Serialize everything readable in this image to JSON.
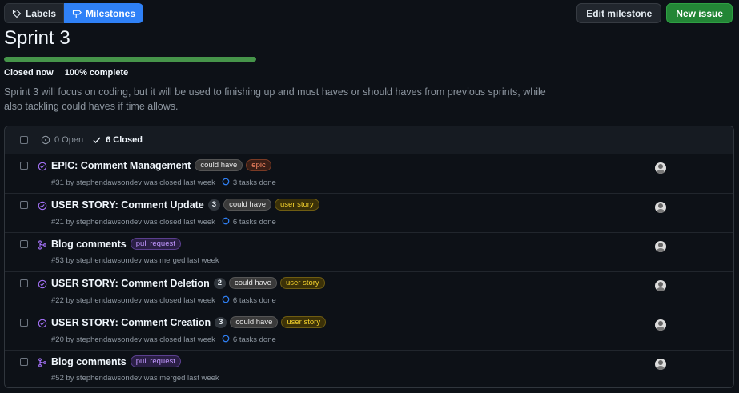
{
  "toolbar": {
    "labels_label": "Labels",
    "milestones_label": "Milestones",
    "edit_milestone_label": "Edit milestone",
    "new_issue_label": "New issue"
  },
  "milestone": {
    "title": "Sprint 3",
    "progress_fraction": 1.0,
    "status": "Closed now",
    "percent_complete": "100% complete",
    "description": "Sprint 3 will focus on coding, but it will be used to finishing up and must haves or should haves from previous sprints, while also tackling could haves if time allows."
  },
  "list_header": {
    "open_label": "0 Open",
    "closed_label": "6 Closed"
  },
  "colors": {
    "accent": "#2f81f7",
    "closed_purple": "#a371f7",
    "primary_green": "#238636"
  },
  "items": [
    {
      "kind": "issue",
      "state_icon": "check-circle-icon",
      "title": "EPIC: Comment Management",
      "count": "",
      "labels": [
        {
          "text": "could have",
          "style": "l-could"
        },
        {
          "text": "epic",
          "style": "l-epic"
        }
      ],
      "meta": "#31 by stephendawsondev was closed last week",
      "tasks": "3 tasks done"
    },
    {
      "kind": "issue",
      "state_icon": "check-circle-icon",
      "title": "USER STORY: Comment Update",
      "count": "3",
      "labels": [
        {
          "text": "could have",
          "style": "l-could"
        },
        {
          "text": "user story",
          "style": "l-story"
        }
      ],
      "meta": "#21 by stephendawsondev was closed last week",
      "tasks": "6 tasks done"
    },
    {
      "kind": "pr",
      "state_icon": "merge-icon",
      "title": "Blog comments",
      "count": "",
      "labels": [
        {
          "text": "pull request",
          "style": "l-pr"
        }
      ],
      "meta": "#53 by stephendawsondev was merged last week",
      "tasks": ""
    },
    {
      "kind": "issue",
      "state_icon": "check-circle-icon",
      "title": "USER STORY: Comment Deletion",
      "count": "2",
      "labels": [
        {
          "text": "could have",
          "style": "l-could"
        },
        {
          "text": "user story",
          "style": "l-story"
        }
      ],
      "meta": "#22 by stephendawsondev was closed last week",
      "tasks": "6 tasks done"
    },
    {
      "kind": "issue",
      "state_icon": "check-circle-icon",
      "title": "USER STORY: Comment Creation",
      "count": "3",
      "labels": [
        {
          "text": "could have",
          "style": "l-could"
        },
        {
          "text": "user story",
          "style": "l-story"
        }
      ],
      "meta": "#20 by stephendawsondev was closed last week",
      "tasks": "6 tasks done"
    },
    {
      "kind": "pr",
      "state_icon": "merge-icon",
      "title": "Blog comments",
      "count": "",
      "labels": [
        {
          "text": "pull request",
          "style": "l-pr"
        }
      ],
      "meta": "#52 by stephendawsondev was merged last week",
      "tasks": ""
    }
  ]
}
